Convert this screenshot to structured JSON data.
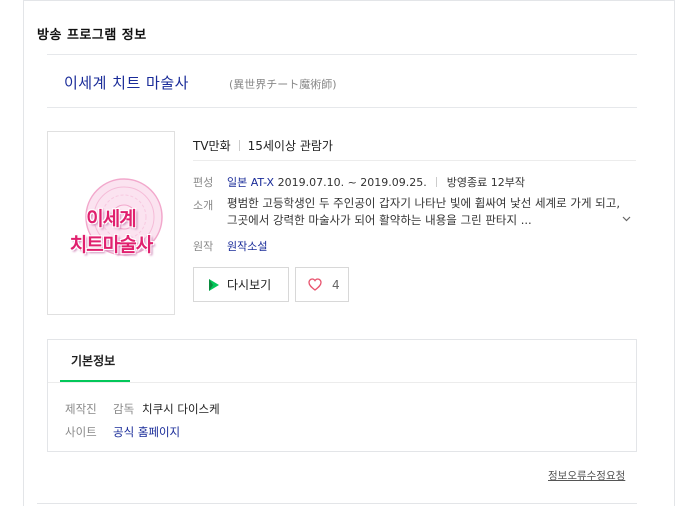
{
  "section": {
    "title": "방송 프로그램 정보"
  },
  "program": {
    "title": "이세계 치트 마술사",
    "original_title": "(異世界チート魔術師)",
    "poster_text_line1": "이세계",
    "poster_text_line2": "치트마술사",
    "genre": "TV만화",
    "rating": "15세이상 관람가"
  },
  "details": {
    "schedule_label": "편성",
    "country": "일본",
    "channel": "AT-X",
    "period": "2019.07.10. ~ 2019.09.25.",
    "status": "방영종료 12부작",
    "synopsis_label": "소개",
    "synopsis": "평범한 고등학생인 두 주인공이 갑자기 나타난 빛에 휩싸여 낯선 세계로 가게 되고, 그곳에서 강력한 마술사가 되어 활약하는 내용을 그린 판타지 ...",
    "more_icon": "chevron-down-icon",
    "original_label": "원작",
    "original_value": "원작소설"
  },
  "actions": {
    "replay_label": "다시보기",
    "like_count": "4"
  },
  "basic_info": {
    "tab_label": "기본정보",
    "production_label": "제작진",
    "director_label": "감독",
    "director_value": "치쿠시 다이스케",
    "site_label": "사이트",
    "site_value": "공식 홈페이지"
  },
  "footer": {
    "report_label": "정보오류수정요청"
  },
  "colors": {
    "link": "#1a2c99",
    "accent": "#03c75a",
    "poster_pink": "#e0206e"
  }
}
